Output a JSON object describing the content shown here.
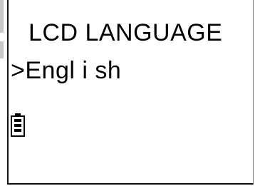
{
  "display": {
    "title": "LCD LANGUAGE",
    "selection_marker": ">",
    "selected_language": "Engl i sh",
    "battery_icon": "battery-icon"
  },
  "colors": {
    "background": "#ffffff",
    "text": "#000000",
    "border": "#111111",
    "side_tab": "#c8c8c8"
  }
}
